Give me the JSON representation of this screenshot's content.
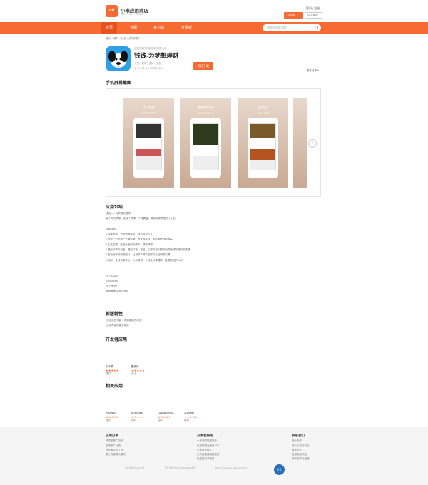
{
  "header": {
    "logo_text": "mi",
    "title": "小米应用商店",
    "subtitle": "APP.MI.COM",
    "login": "登录 | 注册",
    "phone_download": "手机版",
    "pad_download": "平板版"
  },
  "nav": {
    "items": [
      "首页",
      "专题",
      "客户端",
      "开发者"
    ],
    "search_placeholder": "搜索应用或游戏"
  },
  "breadcrumb": "首页  >  理财  >  钱钱-为梦想理财",
  "app": {
    "developer": "成都市鼎力网络科技有限公司",
    "name": "钱钱-为梦想理财",
    "category": "分类：理财  |  支持：全机",
    "rating_count": "( 148次评分 )",
    "stars": "★★★★★",
    "rating": 4.5,
    "install": "直接下载",
    "share": "更多分享"
  },
  "screenshots": {
    "heading": "手机屏幕截图",
    "items": [
      {
        "caption": "写下梦想",
        "sub": "告诉我你的梦想是什么"
      },
      {
        "caption": "梦想绑定基金",
        "sub": "选择合适的理财产品"
      },
      {
        "caption": "生活记账",
        "sub": "记录每一笔收支"
      }
    ]
  },
  "intro": {
    "heading": "应用介绍",
    "lines": [
      "钱钱——为梦想而理财！",
      "每下你的梦想，钱钱个梦想一个储蓄罐，帮你实现梦想的小小目！",
      "",
      "功能特色：",
      "1.创建梦想，为梦想而理财，规划财富人生",
      "2.钱钱一个梦想一个储蓄罐，为梦想存钱，更能享受理财收益。",
      "3.生活性更，给您分配你的资产，帮助梦想！",
      "4.通过分享你记账，通过打钱，钱还，心愿和您小赛的记录还财务情况的清楚。",
      "5.查找到你的消费统计，让您掌了解和您宣存已经消费习惯",
      "6.我的一条钱消费中心，为你提供一个钱会好事理财，生涯财经的入口",
      "",
      "",
      "[官方QQ群]",
      "229000000",
      "[官方微信]",
      "新浪微博 会钱钱理财"
    ]
  },
  "whats_new": {
    "heading": "新版特性",
    "lines": [
      "·修正使系列新，得到更新的体验！",
      "·优化界面的更多体验"
    ]
  },
  "developer_apps": {
    "heading": "开发者应用",
    "items": [
      {
        "name": "卡卡联",
        "stars": "★★★★★",
        "category": "理财"
      },
      {
        "name": "酷我在",
        "stars": "★★★★★",
        "category": "生活"
      }
    ]
  },
  "related": {
    "heading": "相关应用",
    "items": [
      {
        "name": "挖财理财",
        "stars": "★★★★★",
        "category": "理财"
      },
      {
        "name": "随手记理财",
        "stars": "★★★★★",
        "category": "理财"
      },
      {
        "name": "口袋理财-理财...",
        "stars": "★★★★★",
        "category": "理财"
      },
      {
        "name": "富豪理财",
        "stars": "★★★★★",
        "category": "理财"
      }
    ]
  },
  "footer": {
    "col1": {
      "heading": "应用分发",
      "items": [
        "开发者推广应用",
        "应用推广功能",
        "开发者企业工程",
        "第三方服务与游戏"
      ]
    },
    "col2": {
      "heading": "开发者服务",
      "items": [
        "小米消息推送服务",
        "应用数据及统计SDK",
        "小米账号接入",
        "支付及渠道授权服务",
        "电话黑名单服务"
      ]
    },
    "col3": {
      "heading": "联系我们",
      "items": [
        "隐私条款",
        "用户公约与协议",
        "商务合作",
        "应用商店网站",
        "商务合作与运营"
      ]
    },
    "icp": "京ICP备10046444号",
    "license": "京公网安备11010802020134号",
    "copyright": "Mi.com All Rights Reserved 2014",
    "badge_text": "认证"
  },
  "colors": {
    "accent": "#f56b32",
    "accent_dark": "#e8521c",
    "icon_blue": "#2fa0e6"
  }
}
